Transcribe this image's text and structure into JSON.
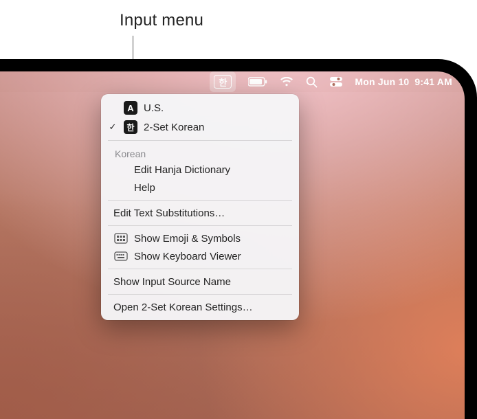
{
  "callout": {
    "label": "Input menu"
  },
  "menubar": {
    "input_glyph": "한",
    "date": "Mon Jun 10",
    "time": "9:41 AM"
  },
  "dropdown": {
    "sources": [
      {
        "label": "U.S.",
        "badge": "A",
        "checked": false
      },
      {
        "label": "2-Set Korean",
        "badge": "한",
        "checked": true
      }
    ],
    "section_header": "Korean",
    "section_items": [
      {
        "label": "Edit Hanja Dictionary"
      },
      {
        "label": "Help"
      }
    ],
    "edit_subs": "Edit Text Substitutions…",
    "show_emoji": "Show Emoji & Symbols",
    "show_keyboard": "Show Keyboard Viewer",
    "show_input_name": "Show Input Source Name",
    "open_settings": "Open 2-Set Korean Settings…"
  }
}
